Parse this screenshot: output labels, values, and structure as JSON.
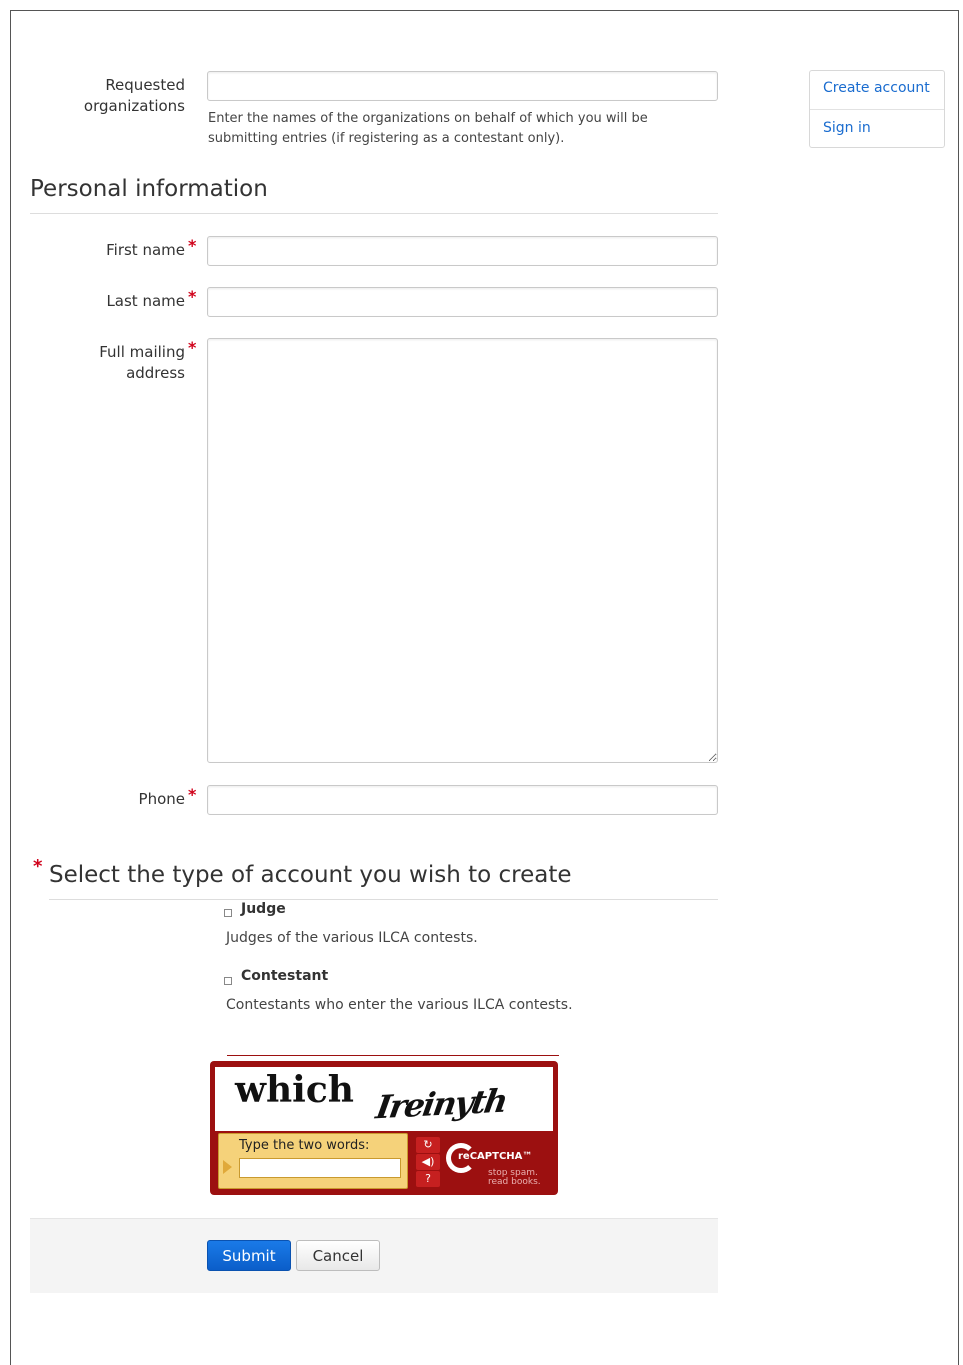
{
  "sidebar": {
    "create_account": "Create account",
    "sign_in": "Sign in"
  },
  "form": {
    "requested_orgs": {
      "label_line1": "Requested",
      "label_line2": "organizations",
      "value": "",
      "help_line1": "Enter the names of the organizations on behalf of which you will be",
      "help_line2": "submitting entries (if registering as a contestant only)."
    },
    "personal_section_title": "Personal information",
    "first_name": {
      "label": "First name",
      "value": ""
    },
    "last_name": {
      "label": "Last name",
      "value": ""
    },
    "mailing_address": {
      "label_line1": "Full mailing",
      "label_line2": "address",
      "value": ""
    },
    "phone": {
      "label": "Phone",
      "value": ""
    },
    "required_mark": "*",
    "account_type_title": "Select the type of account you wish to create",
    "account_types": [
      {
        "title": "Judge",
        "description": "Judges of the various ILCA contests."
      },
      {
        "title": "Contestant",
        "description": "Contestants who enter the various ILCA contests."
      }
    ]
  },
  "captcha": {
    "word1": "which",
    "word2": "Ireinyth",
    "prompt": "Type the two words:",
    "value": "",
    "logo_text": "reCAPTCHA™",
    "tagline_line1": "stop spam.",
    "tagline_line2": "read books.",
    "reload_glyph": "↻",
    "audio_glyph": "◀)",
    "help_glyph": "?"
  },
  "footer": {
    "submit_label": "Submit",
    "cancel_label": "Cancel"
  },
  "colors": {
    "link": "#1a6ccf",
    "required": "#d0021b",
    "submit_bg": "#0b5ec9",
    "captcha_red": "#9c1010",
    "captcha_yellow": "#f5d27a"
  }
}
